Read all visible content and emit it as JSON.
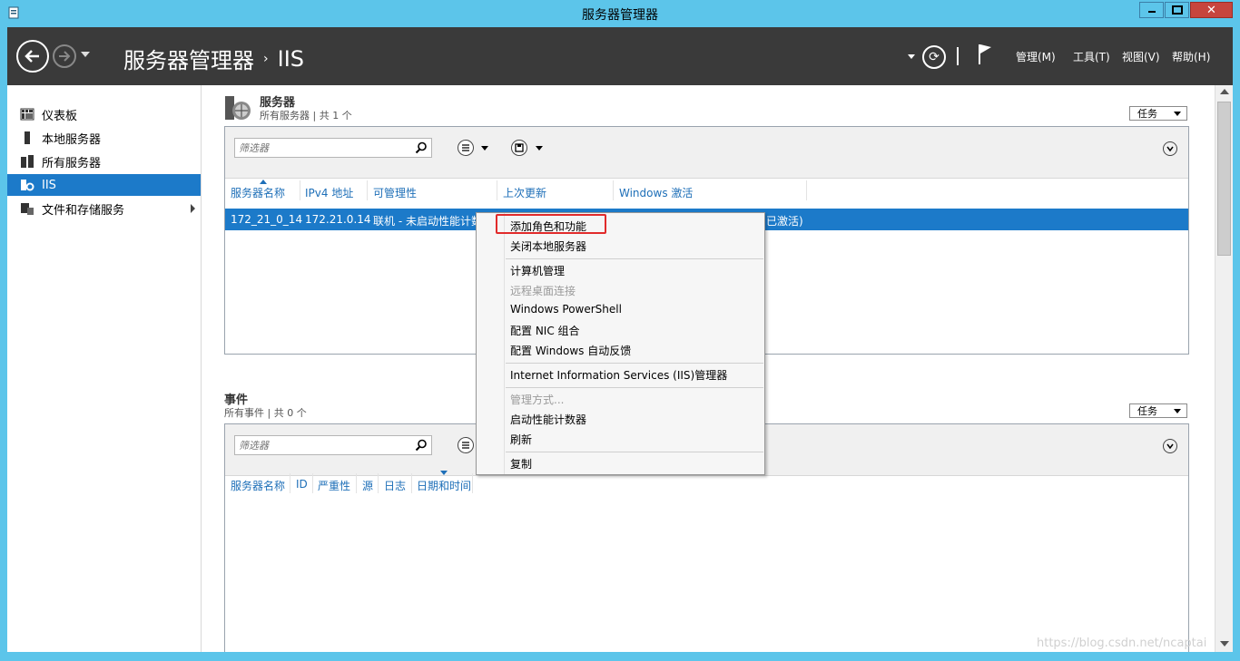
{
  "window": {
    "title": "服务器管理器"
  },
  "header": {
    "breadcrumb_root": "服务器管理器",
    "breadcrumb_sep": "›",
    "breadcrumb_current": "IIS",
    "menus": [
      "管理(M)",
      "工具(T)",
      "视图(V)",
      "帮助(H)"
    ]
  },
  "sidebar": {
    "items": [
      {
        "label": "仪表板",
        "icon": "dashboard-icon"
      },
      {
        "label": "本地服务器",
        "icon": "local-server-icon"
      },
      {
        "label": "所有服务器",
        "icon": "all-servers-icon"
      },
      {
        "label": "IIS",
        "icon": "iis-icon",
        "active": true
      },
      {
        "label": "文件和存储服务",
        "icon": "file-storage-icon"
      }
    ]
  },
  "servers": {
    "title": "服务器",
    "subtitle": "所有服务器 | 共 1 个",
    "tasks_label": "任务",
    "filter_placeholder": "筛选器",
    "columns": [
      "服务器名称",
      "IPv4 地址",
      "可管理性",
      "上次更新",
      "Windows 激活"
    ],
    "rows": [
      {
        "name": "172_21_0_14",
        "ipv4": "172.21.0.14",
        "manageability": "联机 - 未启动性能计数",
        "activation": "已激活)"
      }
    ]
  },
  "events": {
    "title": "事件",
    "subtitle": "所有事件 | 共 0 个",
    "tasks_label": "任务",
    "filter_placeholder": "筛选器",
    "columns": [
      "服务器名称",
      "ID",
      "严重性",
      "源",
      "日志",
      "日期和时间"
    ]
  },
  "context_menu": {
    "items": [
      {
        "label": "添加角色和功能",
        "highlighted": true
      },
      {
        "label": "关闭本地服务器"
      },
      {
        "label": "计算机管理"
      },
      {
        "label": "远程桌面连接",
        "disabled": true
      },
      {
        "label": "Windows PowerShell"
      },
      {
        "label": "配置 NIC 组合"
      },
      {
        "label": "配置 Windows 自动反馈"
      },
      {
        "label": "Internet Information Services (IIS)管理器"
      },
      {
        "label": "管理方式...",
        "disabled": true
      },
      {
        "label": "启动性能计数器"
      },
      {
        "label": "刷新"
      },
      {
        "label": "复制"
      }
    ]
  },
  "watermark": "https://blog.csdn.net/ncaptai",
  "colors": {
    "title_bar": "#5cc5ea",
    "header_bg": "#3a3a3a",
    "selection": "#1c7ac9",
    "link": "#1e6fb8",
    "highlight_box": "#e12b2b"
  }
}
